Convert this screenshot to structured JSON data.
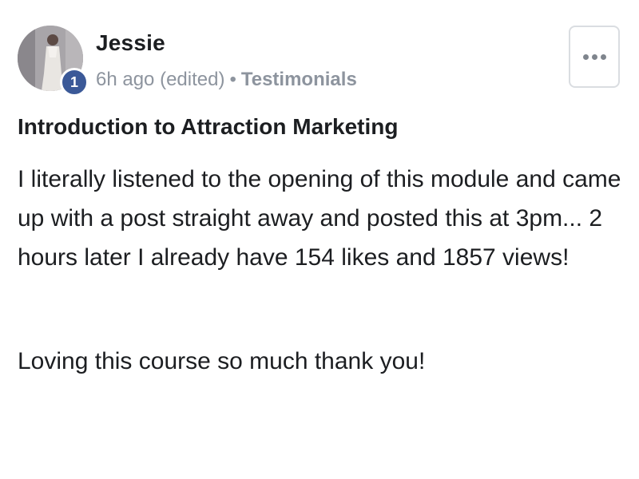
{
  "post": {
    "author": {
      "name": "Jessie",
      "badge_count": "1",
      "avatar_icon": "profile-photo"
    },
    "meta": {
      "time": "6h ago (edited)",
      "separator": "•",
      "group": "Testimonials"
    },
    "more_button_icon": "more-options-dots-icon",
    "title": "Introduction to Attraction Marketing",
    "paragraphs": [
      "I literally listened to the opening of this module and came up with a post straight away and posted this at 3pm... 2 hours later I already have 154 likes and 1857 views!",
      "Loving this course so much thank you!"
    ]
  },
  "colors": {
    "text_primary": "#1c1e21",
    "text_secondary": "#8d949e",
    "badge_bg": "#3b5998",
    "border": "#dadde1"
  }
}
